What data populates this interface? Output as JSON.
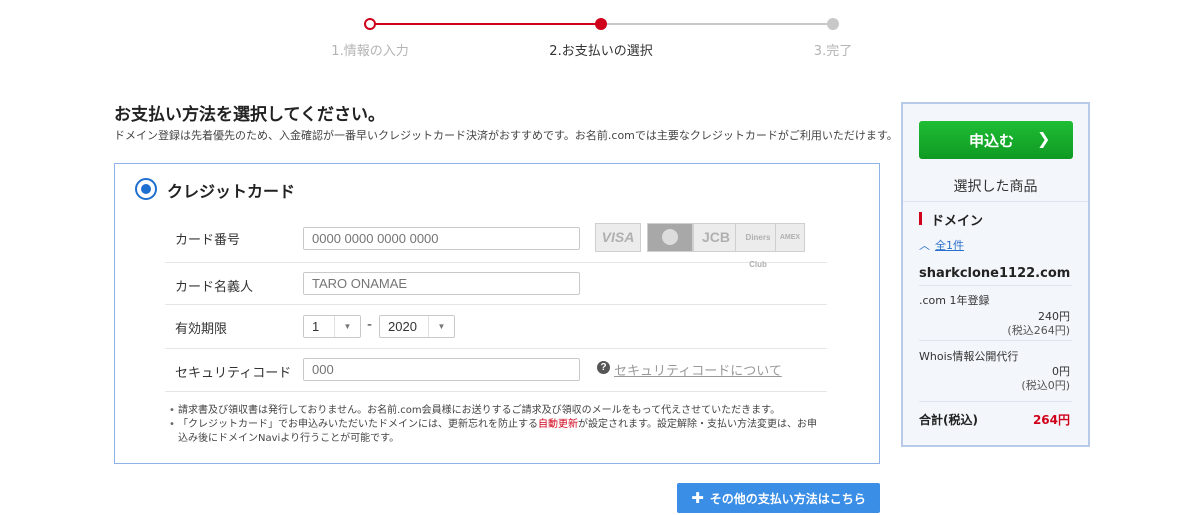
{
  "stepper": {
    "steps": [
      {
        "label": "1.情報の入力",
        "state": "done"
      },
      {
        "label": "2.お支払いの選択",
        "state": "current"
      },
      {
        "label": "3.完了",
        "state": "todo"
      }
    ],
    "colors": {
      "active": "#d0021b",
      "inactive": "#c8c8c8"
    }
  },
  "main": {
    "heading": "お支払い方法を選択してください。",
    "subtext": "ドメイン登録は先着優先のため、入金確認が一番早いクレジットカード決済がおすすめです。お名前.comでは主要なクレジットカードがご利用いただけます。",
    "credit_card": {
      "title": "クレジットカード",
      "selected": true,
      "card_brands": [
        "VISA",
        "MasterCard",
        "JCB",
        "Diners Club",
        "AMEX"
      ],
      "card_number": {
        "label": "カード番号",
        "value": "",
        "placeholder": "0000 0000 0000 0000"
      },
      "card_holder": {
        "label": "カード名義人",
        "value": "",
        "placeholder": "TARO ONAMAE"
      },
      "expiry": {
        "label": "有効期限",
        "month": "1",
        "separator": "-",
        "year": "2020"
      },
      "security_code": {
        "label": "セキュリティコード",
        "value": "",
        "placeholder": "000",
        "help_icon": "question-circle-icon",
        "help_link": "セキュリティコードについて"
      },
      "notes": {
        "note1": "請求書及び領収書は発行しておりません。お名前.com会員様にお送りするご請求及び領収のメールをもって代えさせていただきます。",
        "note2_pre": "「クレジットカード」でお申込みいただいたドメインには、更新忘れを防止する",
        "note2_red": "自動更新",
        "note2_post": "が設定されます。設定解除・支払い方法変更は、お申込み後にドメインNaviより行うことが可能です。"
      }
    },
    "other_methods_button": {
      "icon": "plus-icon",
      "label": "その他の支払い方法はこちら",
      "color": "#3a8ee6"
    }
  },
  "summary": {
    "apply_button": {
      "label": "申込む",
      "icon": "chevron-right-icon",
      "color": "#18ad2d"
    },
    "title": "選択した商品",
    "section": "ドメイン",
    "toggle": {
      "icon": "chevron-up-icon",
      "label": "全1件"
    },
    "domain": "sharkclone1122.com",
    "items": [
      {
        "label": ".com 1年登録",
        "price": "240円",
        "tax_incl": "(税込264円)"
      },
      {
        "label": "Whois情報公開代行",
        "price": "0円",
        "tax_incl": "(税込0円)"
      }
    ],
    "total_label": "合計(税込)",
    "total_value": "264円",
    "total_color": "#d0021b"
  }
}
